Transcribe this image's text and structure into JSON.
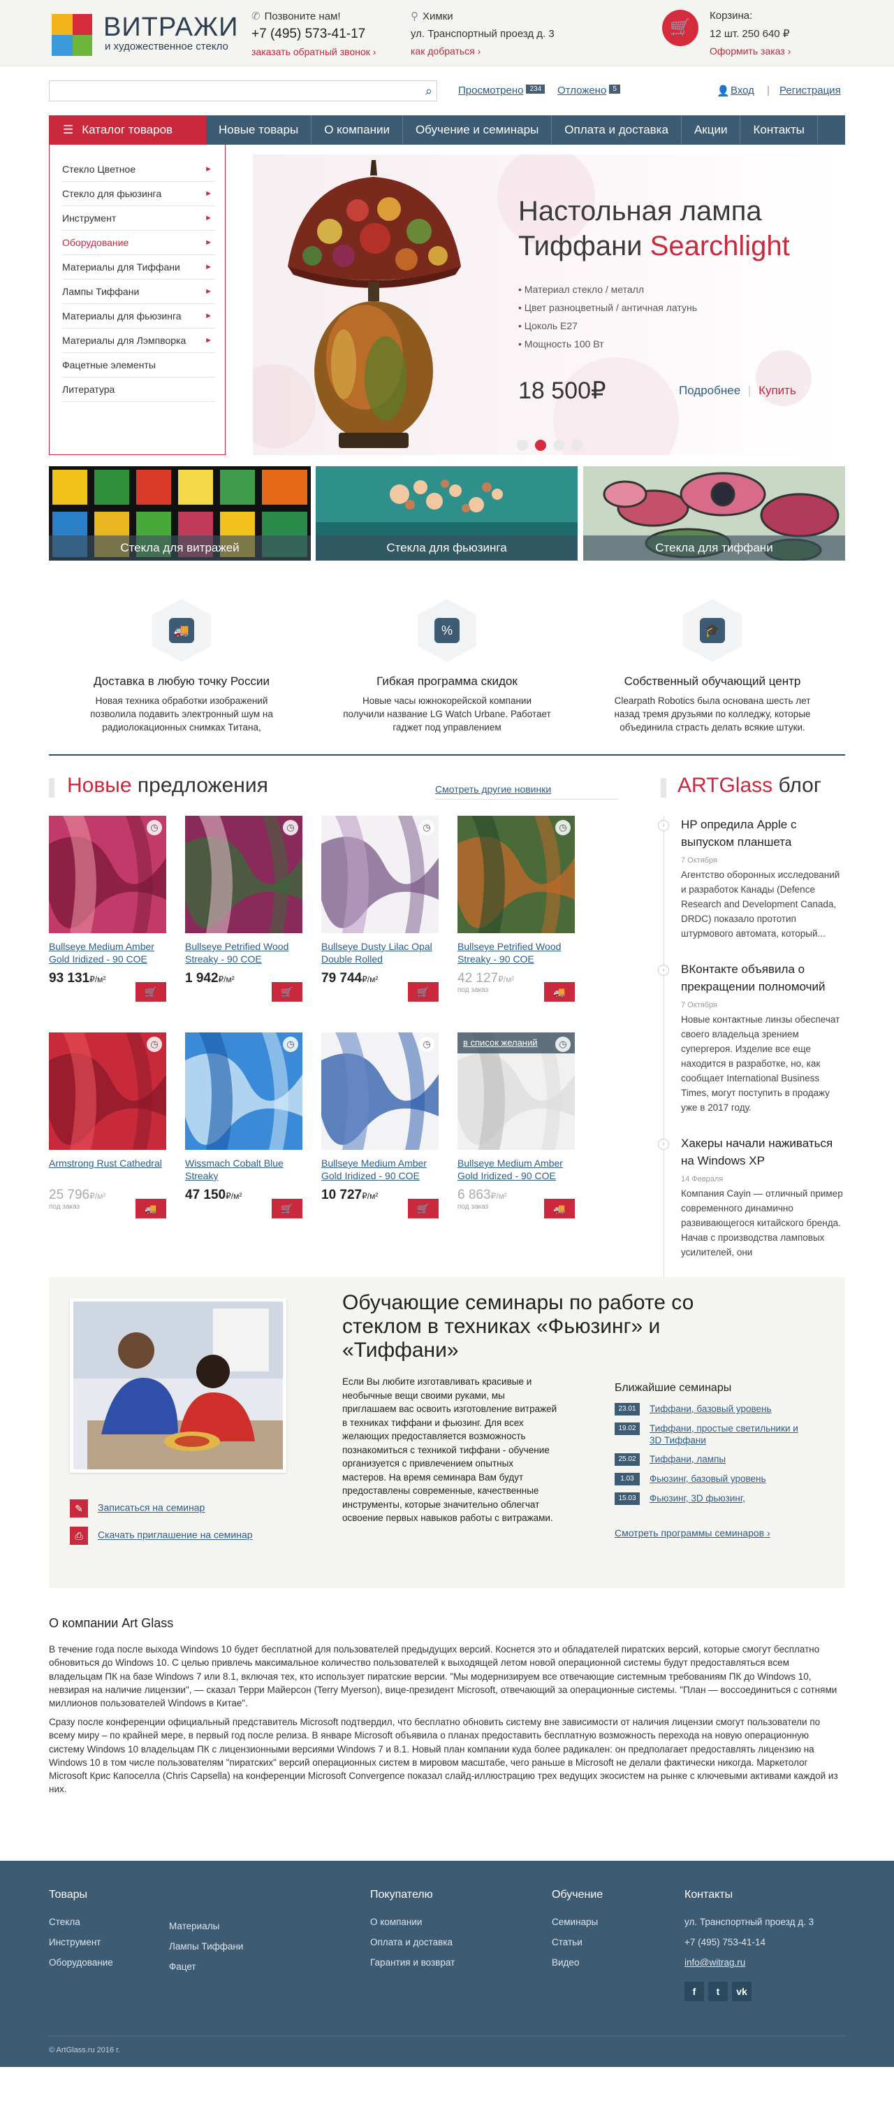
{
  "header": {
    "logo_title": "ВИТРАЖИ",
    "logo_sub": "и художественное стекло",
    "call_label": "Позвоните нам!",
    "phone": "+7 (495) 573-41-17",
    "callback_link": "заказать обратный звонок ›",
    "city": "Химки",
    "address": "ул. Транспортный проезд д. 3",
    "route_link": "как добраться ›",
    "cart_label": "Корзина:",
    "cart_info": "12 шт. 250 640 ₽",
    "checkout_link": "Оформить заказ ›"
  },
  "toolbar": {
    "search_placeholder": "",
    "viewed_label": "Просмотрено",
    "viewed_count": "234",
    "postponed_label": "Отложено",
    "postponed_count": "5",
    "login": "Вход",
    "register": "Регистрация"
  },
  "nav": {
    "catalog": "Каталог товаров",
    "items": [
      "Новые товары",
      "О компании",
      "Обучение и семинары",
      "Оплата и доставка",
      "Акции",
      "Контакты"
    ]
  },
  "catalog": [
    {
      "label": "Стекло Цветное",
      "arrow": true
    },
    {
      "label": "Стекло для фьюзинга",
      "arrow": true
    },
    {
      "label": "Инструмент",
      "arrow": true
    },
    {
      "label": "Оборудование",
      "arrow": true,
      "active": true
    },
    {
      "label": "Материалы для Тиффани",
      "arrow": true
    },
    {
      "label": "Лампы Тиффани",
      "arrow": true
    },
    {
      "label": "Материалы для фьюзинга",
      "arrow": true
    },
    {
      "label": "Материалы для Лэмпворка",
      "arrow": true
    },
    {
      "label": "Фацетные элементы",
      "arrow": false
    },
    {
      "label": "Литература",
      "arrow": false
    }
  ],
  "slider": {
    "title_line1": "Настольная лампа",
    "title_line2": "Тиффани",
    "title_accent": "Searchlight",
    "specs": [
      "• Материал стекло / металл",
      "• Цвет разноцветный / античная латунь",
      "• Цоколь E27",
      "• Мощность 100 Вт"
    ],
    "price": "18 500₽",
    "more": "Подробнее",
    "buy": "Купить",
    "active_dot": 2
  },
  "tiles": [
    "Стекла для витражей",
    "Стекла для фьюзинга",
    "Стекла для тиффани"
  ],
  "features": [
    {
      "icon": "truck-icon",
      "glyph": "🚚",
      "title": "Доставка в любую точку России",
      "text": "Новая техника обработки изображений позволила подавить электронный шум на радиолокационных снимках Титана,"
    },
    {
      "icon": "discount-card-icon",
      "glyph": "%",
      "title": "Гибкая программа скидок",
      "text": "Новые часы южнокорейской компании получили название LG Watch Urbane. Работает гаджет под управлением"
    },
    {
      "icon": "graduation-cap-icon",
      "glyph": "🎓",
      "title": "Собственный обучающий центр",
      "text": "Clearpath Robotics была основана шесть лет назад тремя друзьями по колледжу, которые объединила страсть делать всякие штуки."
    }
  ],
  "products_section": {
    "title_red": "Новые",
    "title_rest": "предложения",
    "see_more": "Смотреть другие новинки"
  },
  "products": [
    {
      "name": "Bullseye Medium Amber Gold Iridized - 90 COE",
      "price": "93 131",
      "unit": "₽/м²",
      "available": true
    },
    {
      "name": "Bullseye Petrified Wood Streaky - 90 COE",
      "price": "1 942",
      "unit": "₽/м²",
      "available": true
    },
    {
      "name": "Bullseye Dusty Lilac Opal Double Rolled",
      "price": "79 744",
      "unit": "₽/м²",
      "available": true
    },
    {
      "name": "Bullseye Petrified Wood Streaky - 90 COE",
      "price": "42 127",
      "unit": "₽/м²",
      "available": false,
      "note": "под заказ"
    },
    {
      "name": "Armstrong Rust Cathedral",
      "price": "25 796",
      "unit": "₽/м²",
      "available": false,
      "note": "под заказ"
    },
    {
      "name": "Wissmach Cobalt Blue Streaky",
      "price": "47 150",
      "unit": "₽/м²",
      "available": true
    },
    {
      "name": "Bullseye Medium Amber Gold Iridized - 90 COE",
      "price": "10 727",
      "unit": "₽/м²",
      "available": true
    },
    {
      "name": "Bullseye Medium Amber Gold Iridized - 90 COE",
      "price": "6 863",
      "unit": "₽/м²",
      "available": false,
      "note": "под заказ",
      "wishlist": "в список желаний"
    }
  ],
  "blog": {
    "title_red": "ARTGlass",
    "title_rest": "блог",
    "posts": [
      {
        "title": "HP опредила Apple с выпуском планшета",
        "date": "7 Октября",
        "text": "Агентство оборонных исследований и разработок Канады (Defence Research and Development Canada, DRDC) показало прототип штурмового автомата, который..."
      },
      {
        "title": "ВКонтакте объявила о прекращении полномочий",
        "date": "7 Октября",
        "text": "Новые контактные линзы обеспечат своего владельца зрением супергероя. Изделие все еще находится в разработке, но, как сообщает International Business Times, могут поступить в продажу уже в 2017 году."
      },
      {
        "title": "Хакеры начали наживаться на Windows XP",
        "date": "14 Февраля",
        "text": "Компания Cayin — отличный пример современного динамично развивающегося китайского бренда. Начав с производства ламповых усилителей, они"
      }
    ]
  },
  "seminars": {
    "title": "Обучающие семинары по работе со стеклом в техниках «Фьюзинг» и «Тиффани»",
    "text": "Если Вы любите изготавливать красивые и необычные вещи своими руками, мы приглашаем вас освоить изготовление витражей в техниках тиффани и фьюзинг. Для всех желающих предоставляется возможность познакомиться с техникой тиффани - обучение организуется с привлечением опытных мастеров. На время семинара Вам будут предоставлены современные, качественные инструменты, которые значительно облегчат освоение первых навыков работы с витражами.",
    "signup": "Записаться на семинар",
    "download": "Скачать приглашение на семинар",
    "nearest_label": "Ближайшие семинары",
    "list": [
      {
        "date": "23.01",
        "label": "Тиффани, базовый уровень"
      },
      {
        "date": "19.02",
        "label": "Тиффани, простые светильники и 3D Тиффани"
      },
      {
        "date": "25.02",
        "label": "Тиффани, лампы"
      },
      {
        "date": "1.03",
        "label": "Фьюзинг, базовый уровень"
      },
      {
        "date": "15.03",
        "label": "Фьюзинг, 3D фьюзинг,"
      }
    ],
    "all": "Смотреть программы семинаров ›"
  },
  "about": {
    "title": "О компании Art Glass",
    "p1": "В течение года после выхода Windows 10 будет бесплатной для пользователей предыдущих версий. Коснется это и обладателей пиратских версий, которые смогут бесплатно обновиться до Windows 10. С целью привлечь максимальное количество пользователей к выходящей летом новой операционной системы будут предоставляться всем владельцам ПК на базе Windows 7 или 8.1, включая тех, кто использует пиратские версии. \"Мы модернизируем все отвечающие системным требованиям ПК до Windows 10, невзирая на наличие лицензии\", — сказал Терри Майерсон (Terry Myerson), вице-президент Microsoft, отвечающий за операционные системы. \"План — воссоединиться с сотнями миллионов пользователей Windows в Китае\".",
    "p2": "Сразу после конференции официальный представитель Microsoft подтвердил, что бесплатно обновить систему вне зависимости от наличия лицензии смогут пользователи по всему миру – по крайней мере, в первый год после релиза. В январе Microsoft объявила о планах предоставить бесплатную возможность перехода на новую операционную систему Windows 10 владельцам ПК с лицензионными версиями Windows 7 и 8.1. Новый план компании куда более радикален: он предполагает предоставлять лицензию на Windows 10 в том числе пользователям \"пиратских\" версий операционных систем в мировом масштабе, чего раньше в Microsoft не делали фактически никогда. Маркетолог Microsoft Крис Капоселла (Chris Capsella) на конференции Microsoft Convergence показал слайд-иллюстрацию трех ведущих экосистем на рынке с ключевыми активами каждой из них."
  },
  "footer": {
    "goods_title": "Товары",
    "goods_col1": [
      "Стекла",
      "Инструмент",
      "Оборудование"
    ],
    "goods_col2": [
      "Материалы",
      "Лампы Тиффани",
      "Фацет"
    ],
    "buyer_title": "Покупателю",
    "buyer": [
      "О компании",
      "Оплата и доставка",
      "Гарантия и возврат"
    ],
    "edu_title": "Обучение",
    "edu": [
      "Семинары",
      "Статьи",
      "Видео"
    ],
    "contacts_title": "Контакты",
    "address": "ул. Транспортный проезд д. 3",
    "phone": "+7 (495) 753-41-14",
    "email": "info@witrag.ru",
    "copyright": "© ArtGlass.ru 2016 г."
  },
  "colors": {
    "accent": "#c9283d",
    "nav": "#3d5b72",
    "link": "#2c5d8a",
    "header_bg": "#f4f4f1"
  }
}
